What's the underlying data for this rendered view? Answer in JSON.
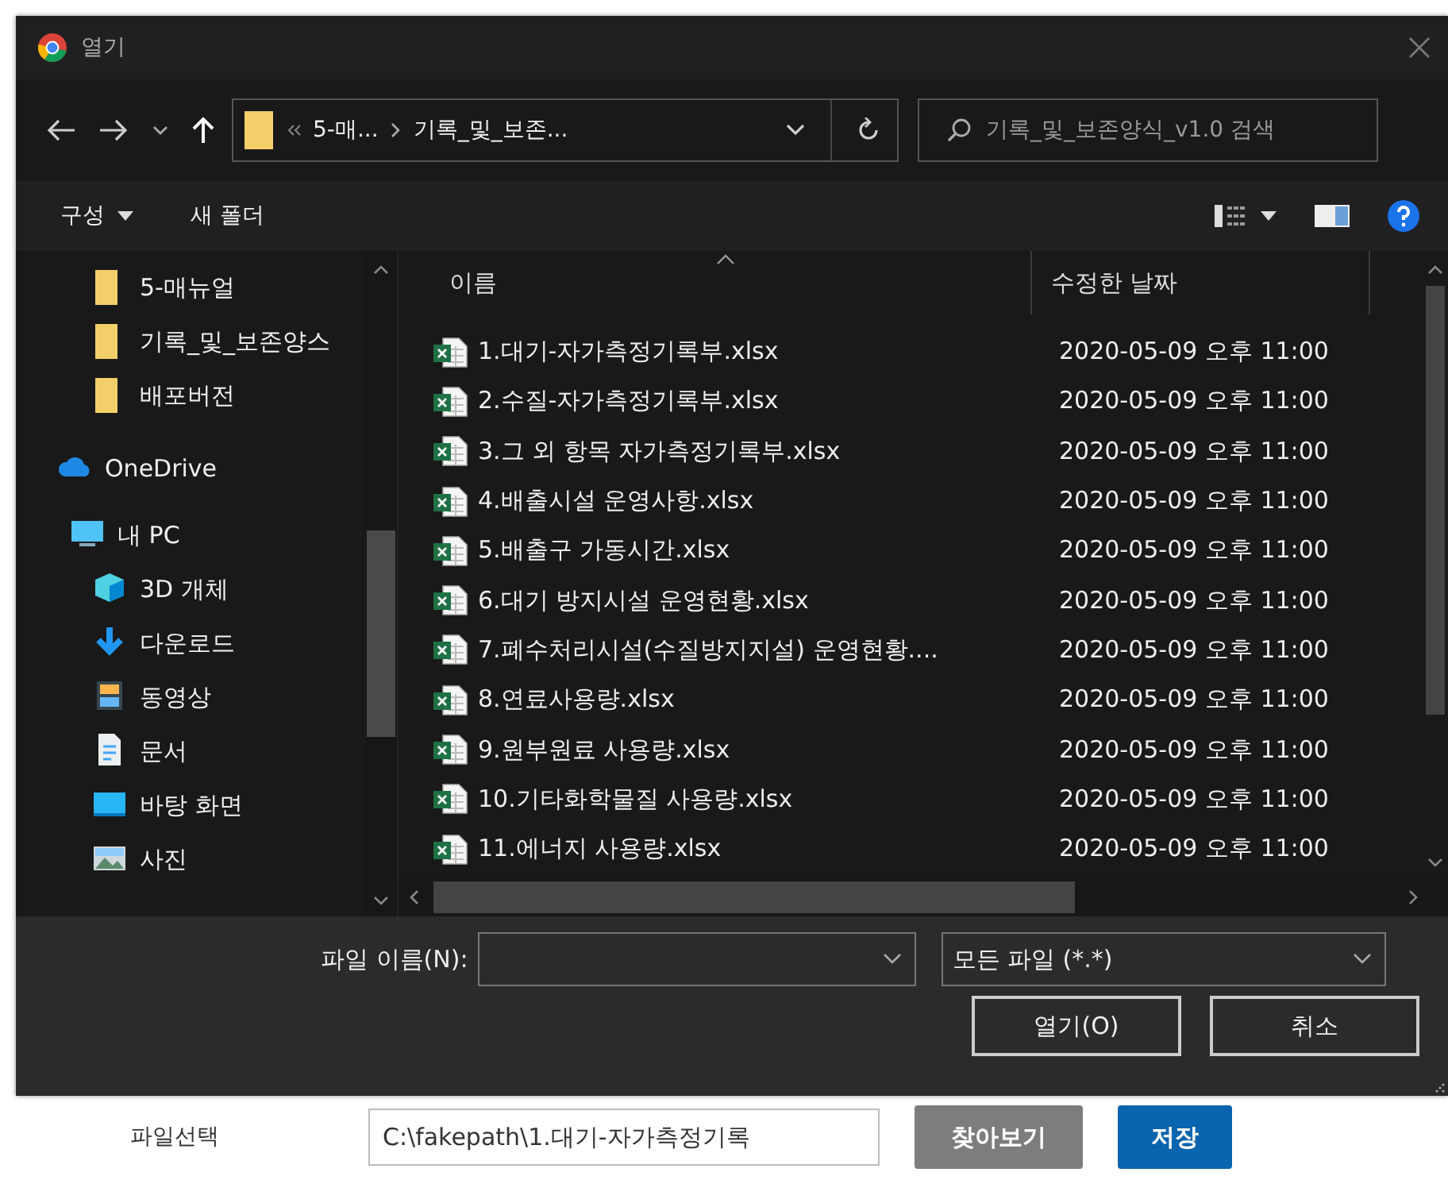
{
  "window": {
    "title": "열기"
  },
  "nav": {
    "path": [
      {
        "label": "5-매..."
      },
      {
        "label": "기록_및_보존..."
      }
    ],
    "search": {
      "placeholder": "기록_및_보존양식_v1.0 검색"
    }
  },
  "toolbar": {
    "organize": "구성",
    "new_folder": "새 폴더"
  },
  "sidebar": {
    "items": [
      {
        "kind": "folder",
        "label": "5-매뉴얼"
      },
      {
        "kind": "folder",
        "label": "기록_및_보존양스"
      },
      {
        "kind": "folder",
        "label": "배포버전"
      },
      {
        "kind": "cloud",
        "label": "OneDrive"
      },
      {
        "kind": "pc",
        "label": "내 PC",
        "children": [
          {
            "kind": "cube",
            "label": "3D 개체"
          },
          {
            "kind": "download",
            "label": "다운로드"
          },
          {
            "kind": "video",
            "label": "동영상"
          },
          {
            "kind": "document",
            "label": "문서"
          },
          {
            "kind": "desktop",
            "label": "바탕 화면"
          },
          {
            "kind": "picture",
            "label": "사진"
          }
        ]
      }
    ]
  },
  "table": {
    "columns": [
      "이름",
      "수정한 날짜"
    ],
    "rows": [
      {
        "name": "1.대기-자가측정기록부.xlsx",
        "date": "2020-05-09 오후 11:00"
      },
      {
        "name": "2.수질-자가측정기록부.xlsx",
        "date": "2020-05-09 오후 11:00"
      },
      {
        "name": "3.그 외 항목 자가측정기록부.xlsx",
        "date": "2020-05-09 오후 11:00"
      },
      {
        "name": "4.배출시설 운영사항.xlsx",
        "date": "2020-05-09 오후 11:00"
      },
      {
        "name": "5.배출구 가동시간.xlsx",
        "date": "2020-05-09 오후 11:00"
      },
      {
        "name": "6.대기 방지시설 운영현황.xlsx",
        "date": "2020-05-09 오후 11:00"
      },
      {
        "name": "7.폐수처리시설(수질방지지설) 운영현황....",
        "date": "2020-05-09 오후 11:00"
      },
      {
        "name": "8.연료사용량.xlsx",
        "date": "2020-05-09 오후 11:00"
      },
      {
        "name": "9.원부원료 사용량.xlsx",
        "date": "2020-05-09 오후 11:00"
      },
      {
        "name": "10.기타화학물질 사용량.xlsx",
        "date": "2020-05-09 오후 11:00"
      },
      {
        "name": "11.에너지 사용량.xlsx",
        "date": "2020-05-09 오후 11:00"
      }
    ]
  },
  "footer": {
    "filename_label": "파일 이름(N):",
    "filetype": "모든 파일 (*.*)",
    "buttons": [
      "열기(O)",
      "취소"
    ]
  },
  "page": {
    "label": "파일선택",
    "path_value": "C:\\fakepath\\1.대기-자가측정기록",
    "buttons": [
      {
        "label": "찾아보기",
        "kind": "secondary"
      },
      {
        "label": "저장",
        "kind": "primary"
      }
    ]
  }
}
